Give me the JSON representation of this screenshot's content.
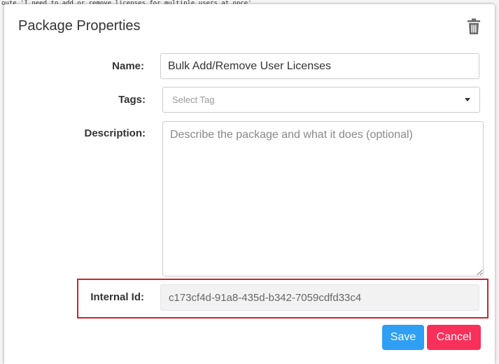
{
  "background": {
    "code_line": "oute 'I need to add or remove licenses for multiple users at once'"
  },
  "dialog": {
    "title": "Package Properties",
    "delete_icon": "trash-icon",
    "name": {
      "label": "Name:",
      "value": "Bulk Add/Remove User Licenses"
    },
    "tags": {
      "label": "Tags:",
      "placeholder": "Select Tag"
    },
    "description": {
      "label": "Description:",
      "placeholder": "Describe the package and what it does (optional)",
      "value": ""
    },
    "internal_id": {
      "label": "Internal Id:",
      "value": "c173cf4d-91a8-435d-b342-7059cdfd33c4"
    },
    "buttons": {
      "save": "Save",
      "cancel": "Cancel"
    }
  },
  "colors": {
    "save": "#2e9ff3",
    "cancel": "#f8305a",
    "highlight": "#d3202f"
  }
}
